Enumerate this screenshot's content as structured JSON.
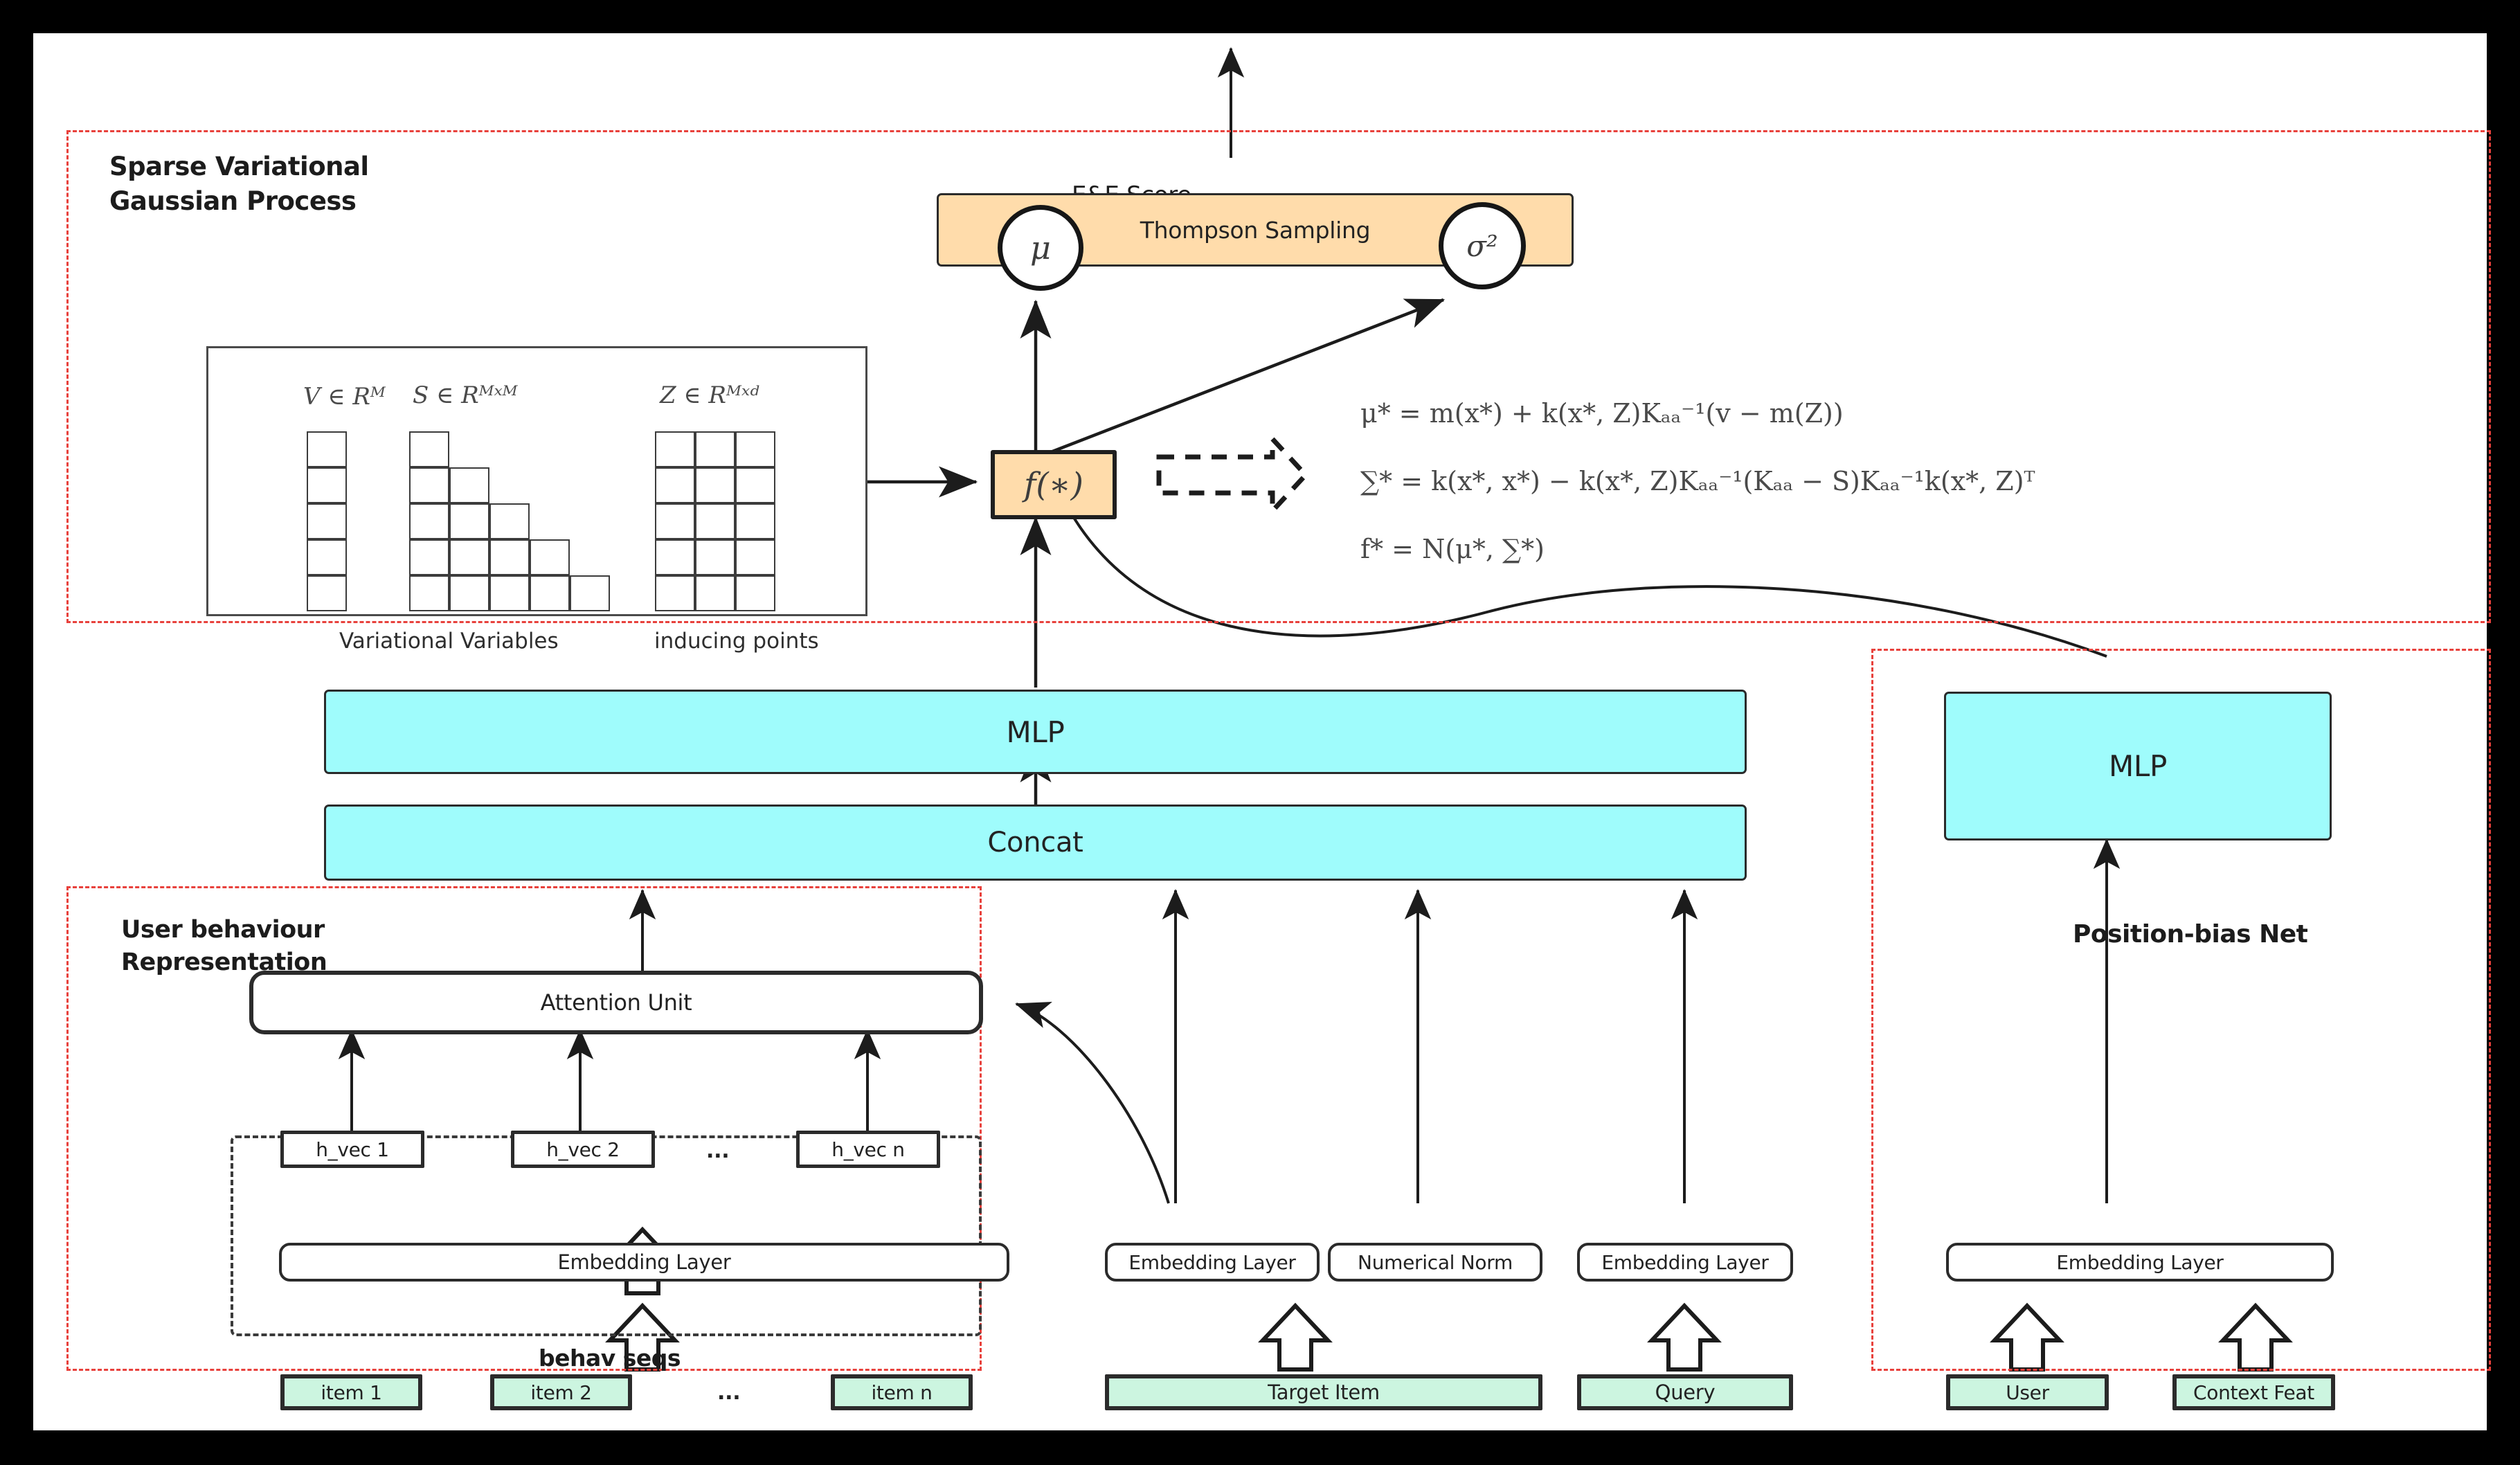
{
  "figure": {
    "title_hidden": "",
    "background": "#ffffff",
    "accent_group_color": "#e8413c",
    "cyan": "#9ffcfc",
    "orange": "#ffdcab",
    "green": "#ccf5e0"
  },
  "groups": {
    "svgp": {
      "label": "Sparse Variational\nGaussian Process"
    },
    "user_behaviour": {
      "label": "User behaviour\nRepresentation"
    },
    "position_bias": {
      "label": "Position-bias Net"
    },
    "behav_seqs": {
      "label": "behav seqs"
    }
  },
  "svgp": {
    "ee_score_label": "E&E Score",
    "thompson": {
      "label": "Thompson Sampling",
      "mu_label": "μ",
      "sigma_label": "σ²"
    },
    "f_star_label": "f(∗)",
    "variational_box": {
      "v_label": "V ∈ Rᴹ",
      "s_label": "S ∈ Rᴹˣᴹ",
      "z_label": "Z ∈ Rᴹˣᵈ",
      "caption_left": "Variational Variables",
      "caption_right": "inducing points",
      "v_rows": 5,
      "s_rows": [
        1,
        2,
        3,
        4,
        5
      ],
      "z_rows": 5,
      "z_cols": 3
    },
    "equations": [
      "μ* = m(x*) + k(x*, Z)Kₐₐ⁻¹(v − m(Z))",
      "∑* = k(x*, x*) − k(x*, Z)Kₐₐ⁻¹(Kₐₐ − S)Kₐₐ⁻¹k(x*, Z)ᵀ",
      "f* = N(μ*, ∑*)"
    ]
  },
  "main_stack": {
    "mlp_label": "MLP",
    "concat_label": "Concat"
  },
  "user_behaviour": {
    "attention_unit_label": "Attention Unit",
    "embedding_layer_label": "Embedding Layer",
    "h_vecs": [
      "h_vec 1",
      "h_vec 2",
      "h_vec n"
    ],
    "h_vec_ellipsis": "...",
    "items": [
      "item 1",
      "item 2",
      "item n"
    ],
    "item_ellipsis": "..."
  },
  "target_column": {
    "embedding_layer_label": "Embedding Layer",
    "numerical_norm_label": "Numerical Norm",
    "target_item_label": "Target Item"
  },
  "query_column": {
    "embedding_layer_label": "Embedding Layer",
    "query_label": "Query"
  },
  "position_bias": {
    "mlp_label": "MLP",
    "embedding_layer_label": "Embedding Layer",
    "user_label": "User",
    "context_feat_label": "Context Feat"
  }
}
